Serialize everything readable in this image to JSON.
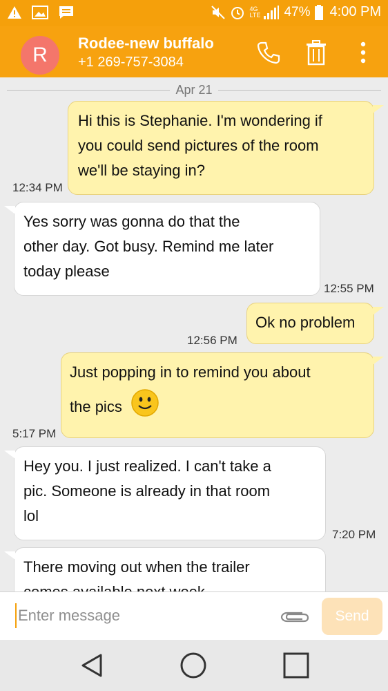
{
  "status_bar": {
    "battery": "47%",
    "time": "4:00 PM",
    "network": "4G LTE",
    "icons": [
      "warning-icon",
      "image-icon",
      "message-icon",
      "mute-icon",
      "alarm-icon",
      "signal-icon",
      "battery-icon"
    ]
  },
  "header": {
    "avatar_letter": "R",
    "name": "Rodee-new buffalo",
    "number": "+1 269-757-3084",
    "icons": [
      "phone-icon",
      "trash-icon",
      "more-icon"
    ]
  },
  "conversation": {
    "date": "Apr 21",
    "messages": [
      {
        "direction": "outgoing",
        "lines": [
          "Hi this is Stephanie. I'm wondering if",
          "you could send pictures of the room",
          "we'll be staying in?"
        ],
        "time": "12:34 PM"
      },
      {
        "direction": "incoming",
        "lines": [
          "Yes sorry was gonna do that the",
          "other day. Got busy. Remind me later",
          "today please"
        ],
        "time": "12:55 PM"
      },
      {
        "direction": "outgoing",
        "lines": [
          "Ok no problem"
        ],
        "time": "12:56 PM"
      },
      {
        "direction": "outgoing",
        "lines": [
          "Just popping in to remind you about",
          "the pics"
        ],
        "emoji": "smiley",
        "time": "5:17 PM"
      },
      {
        "direction": "incoming",
        "lines": [
          "Hey you. I just realized. I can't take a",
          "pic. Someone is already in that room",
          "lol"
        ],
        "time": "7:20 PM"
      },
      {
        "direction": "incoming",
        "lines": [
          "There moving out when the trailer",
          "comes available next week"
        ],
        "time": ""
      }
    ]
  },
  "compose": {
    "placeholder": "Enter message",
    "send_label": "Send",
    "attach_icon": "paperclip-icon"
  },
  "nav": {
    "icons": [
      "back-icon",
      "home-icon",
      "recents-icon"
    ]
  },
  "colors": {
    "accent": "#f7a20f",
    "outgoing_bubble": "#fff3ad",
    "incoming_bubble": "#ffffff",
    "avatar": "#f4766b"
  }
}
